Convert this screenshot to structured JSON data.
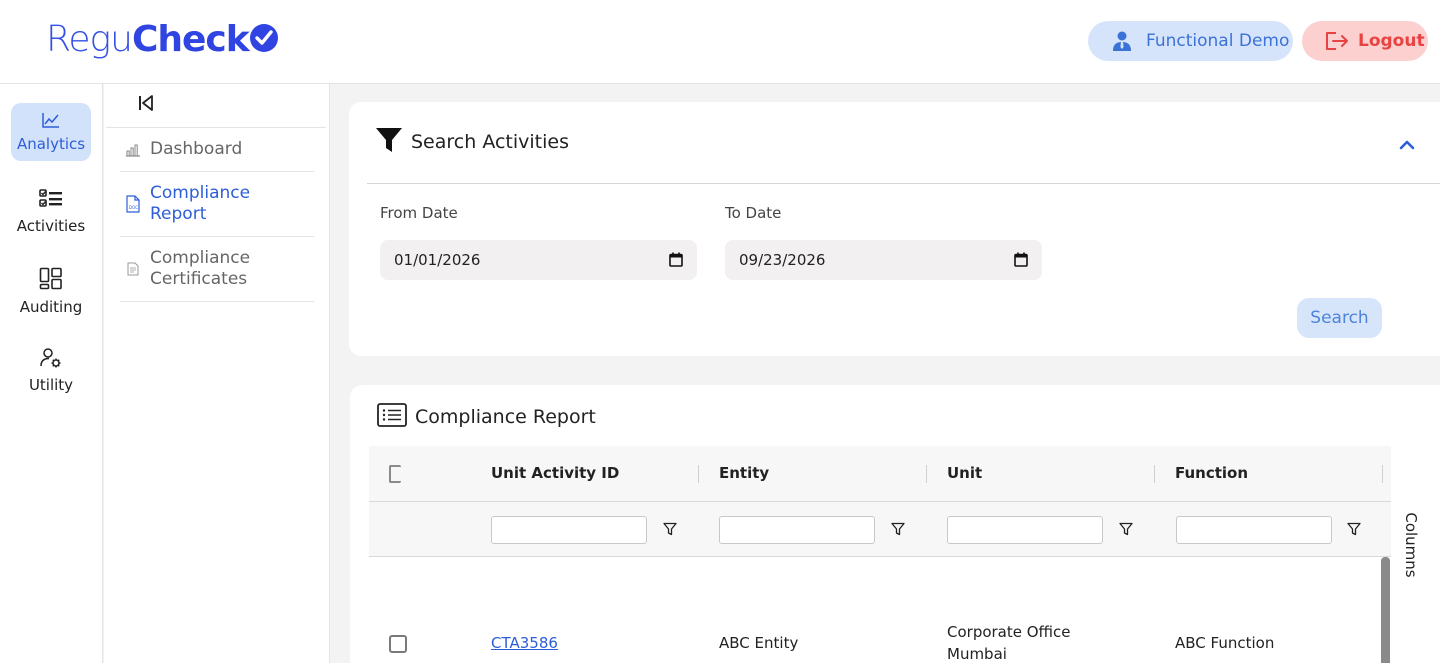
{
  "brand": {
    "logo_light": "Regu",
    "logo_bold": "Check"
  },
  "header": {
    "user_label": "Functional Demo",
    "logout_label": "Logout"
  },
  "rail": {
    "items": [
      {
        "label": "Analytics",
        "icon": "chart-line-icon",
        "active": true
      },
      {
        "label": "Activities",
        "icon": "checklist-icon",
        "active": false
      },
      {
        "label": "Auditing",
        "icon": "dashboard-layout-icon",
        "active": false
      },
      {
        "label": "Utility",
        "icon": "user-gear-icon",
        "active": false
      }
    ]
  },
  "subnav": {
    "items": [
      {
        "label": "Dashboard",
        "icon": "bar-chart-icon",
        "active": false
      },
      {
        "label": "Compliance Report",
        "icon": "document-icon",
        "active": true
      },
      {
        "label": "Compliance Certificates",
        "icon": "certificate-icon",
        "active": false
      }
    ]
  },
  "search": {
    "title": "Search Activities",
    "from_label": "From Date",
    "from_value": "01/01/2026",
    "to_label": "To Date",
    "to_value": "09/23/2026",
    "button_label": "Search"
  },
  "report": {
    "title": "Compliance Report",
    "columns": [
      "Unit Activity ID",
      "Entity",
      "Unit",
      "Function"
    ],
    "rows": [
      {
        "unit_activity_id": "CTA3586",
        "entity": "ABC Entity",
        "unit": "Corporate Office Mumbai",
        "function": "ABC Function"
      }
    ],
    "side_tab_label": "Columns"
  },
  "colors": {
    "accent": "#2c5ed8",
    "active_bg": "#d3e2fb",
    "logout_bg": "#fbd0cf",
    "logout_text": "#e74343"
  }
}
